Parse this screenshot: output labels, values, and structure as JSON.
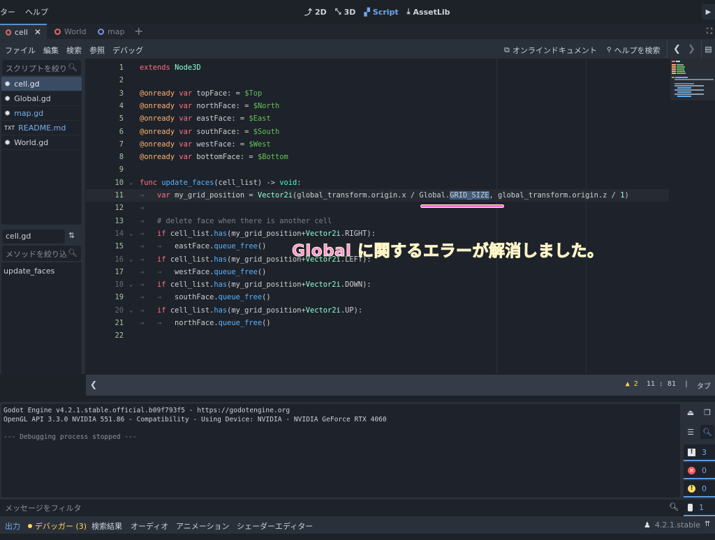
{
  "top_menu": {
    "items": [
      "ター",
      "ヘルプ"
    ]
  },
  "workspaces": [
    {
      "label": "2D",
      "icon": "2d-icon",
      "active": false
    },
    {
      "label": "3D",
      "icon": "3d-icon",
      "active": false
    },
    {
      "label": "Script",
      "icon": "script-icon",
      "active": true
    },
    {
      "label": "AssetLib",
      "icon": "download-icon",
      "active": false
    }
  ],
  "scene_tabs": [
    {
      "label": "cell",
      "active": true,
      "ring": "red"
    },
    {
      "label": "World",
      "active": false,
      "ring": "red"
    },
    {
      "label": "map",
      "active": false,
      "ring": "blue"
    }
  ],
  "script_menu": {
    "items": [
      "ファイル",
      "編集",
      "検索",
      "参照",
      "デバッグ"
    ],
    "online_docs": "オンラインドキュメント",
    "search_help": "ヘルプを検索"
  },
  "script_panel": {
    "filter_placeholder": "スクリプトを絞り",
    "scripts": [
      {
        "name": "cell.gd",
        "selected": true,
        "color": "default"
      },
      {
        "name": "Global.gd",
        "selected": false,
        "color": "default"
      },
      {
        "name": "map.gd",
        "selected": false,
        "color": "blue"
      },
      {
        "name": "README.md",
        "selected": false,
        "color": "blue"
      },
      {
        "name": "World.gd",
        "selected": false,
        "color": "default"
      }
    ],
    "current_script": "cell.gd",
    "method_filter_placeholder": "メソッドを絞り込",
    "methods": [
      "update_faces"
    ]
  },
  "editor": {
    "current_line": 11,
    "lines": [
      "1",
      "2",
      "3",
      "4",
      "5",
      "6",
      "7",
      "8",
      "9",
      "10",
      "11",
      "12",
      "13",
      "14",
      "15",
      "16",
      "17",
      "18",
      "19",
      "20",
      "21",
      "22"
    ]
  },
  "annotation": {
    "text": "Global に関するエラーが解消しました。",
    "color": "#ff8fe0"
  },
  "status_bar": {
    "warnings": "2",
    "line": "11",
    "column": "81",
    "indent": "タブ"
  },
  "output": {
    "lines": [
      "Godot Engine v4.2.1.stable.official.b09f793f5 - https://godotengine.org",
      "OpenGL API 3.3.0 NVIDIA 551.86 - Compatibility - Using Device: NVIDIA - NVIDIA GeForce RTX 4060",
      "",
      "--- Debugging process stopped ---"
    ],
    "filter_placeholder": "メッセージをフィルタ",
    "counts": {
      "messages": "3",
      "errors": "0",
      "warnings": "0",
      "editor": "1"
    }
  },
  "bottom_tabs": [
    {
      "label": "出力",
      "state": "active"
    },
    {
      "label": "デバッガー (3)",
      "state": "debug"
    },
    {
      "label": "検索結果",
      "state": "normal"
    },
    {
      "label": "オーディオ",
      "state": "normal"
    },
    {
      "label": "アニメーション",
      "state": "normal"
    },
    {
      "label": "シェーダーエディター",
      "state": "normal"
    }
  ],
  "version": "4.2.1.stable"
}
